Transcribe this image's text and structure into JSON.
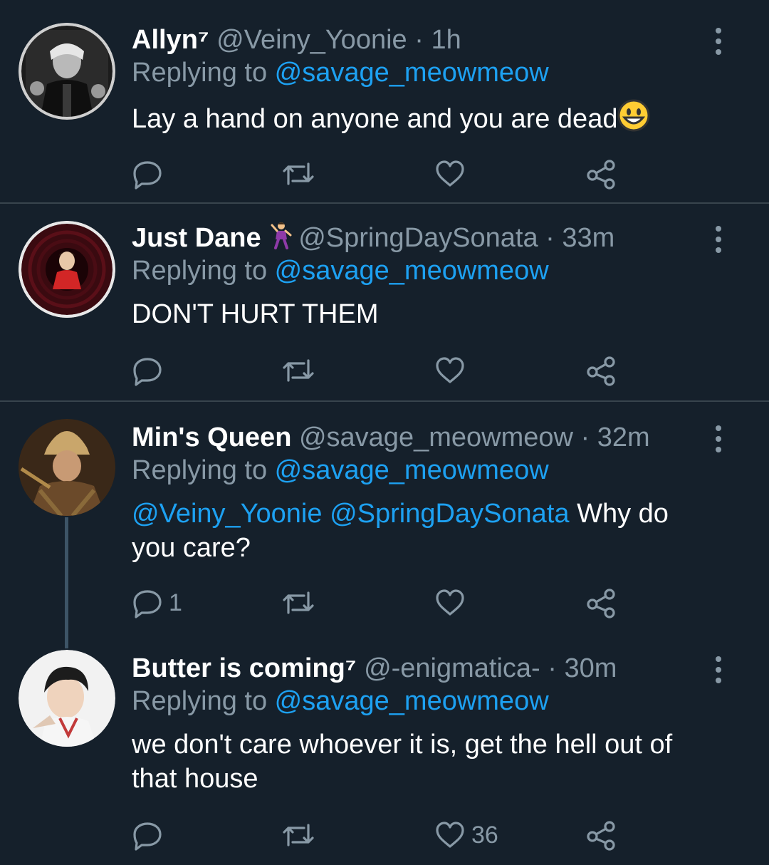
{
  "tweets": [
    {
      "name": "Allyn⁷",
      "handle": "@Veiny_Yoonie",
      "sep": " · ",
      "time": "1h",
      "replying_prefix": "Replying to ",
      "replying_to": "@savage_meowmeow",
      "text": "Lay a hand on anyone and you are dead",
      "emoji": "grinning-face",
      "reply_count": "",
      "like_count": ""
    },
    {
      "name": "Just Dane",
      "name_emoji": "dancer",
      "handle": "@SpringDaySonata",
      "sep": " · ",
      "time": "33m",
      "replying_prefix": "Replying to ",
      "replying_to": "@savage_meowmeow",
      "text": "DON'T HURT THEM",
      "reply_count": "",
      "like_count": ""
    },
    {
      "name": "Min's Queen",
      "handle": "@savage_meowmeow",
      "sep": " · ",
      "time": "32m",
      "replying_prefix": "Replying to ",
      "replying_to": "@savage_meowmeow",
      "mention1": "@Veiny_Yoonie",
      "mention2": "@SpringDaySonata",
      "text": " Why do you care?",
      "reply_count": "1",
      "like_count": ""
    },
    {
      "name": "Butter is coming⁷",
      "handle": "@-enigmatica-",
      "sep": " · ",
      "time": "30m",
      "replying_prefix": "Replying to ",
      "replying_to": "@savage_meowmeow",
      "text": "we don't care whoever it is, get the hell out of that house",
      "reply_count": "",
      "like_count": "36"
    }
  ],
  "icons": {
    "reply": "reply-icon",
    "retweet": "retweet-icon",
    "like": "like-icon",
    "share": "share-icon",
    "more": "more-options-icon"
  },
  "colors": {
    "background": "#15202b",
    "primary_text": "#ffffff",
    "secondary_text": "#8899a6",
    "link": "#1da1f2",
    "divider": "#38444d"
  }
}
